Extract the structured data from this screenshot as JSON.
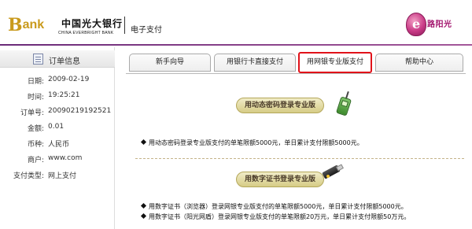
{
  "header": {
    "bank_logo_b": "B",
    "bank_logo_rest": "ank",
    "bank_name_cn": "中国光大银行",
    "bank_name_en": "CHINA EVERBRIGHT BANK",
    "section_title": "电子支付",
    "brand_right": "路阳光"
  },
  "sidebar": {
    "title": "订单信息",
    "rows": [
      {
        "label": "日期:",
        "value": "2009-02-19"
      },
      {
        "label": "时间:",
        "value": "19:25:21"
      },
      {
        "label": "订单号:",
        "value": "20090219192521"
      },
      {
        "label": "金额:",
        "value": "0.01"
      },
      {
        "label": "币种:",
        "value": "人民币"
      },
      {
        "label": "商户:",
        "value": "www.com"
      },
      {
        "label": "支付类型:",
        "value": "网上支付"
      }
    ]
  },
  "tabs": [
    {
      "label": "新手向导",
      "active": false
    },
    {
      "label": "用银行卡直接支付",
      "active": false
    },
    {
      "label": "用网银专业版支付",
      "active": true
    },
    {
      "label": "帮助中心",
      "active": false
    }
  ],
  "content": {
    "dynamic_password": {
      "button_label": "用动态密码登录专业版",
      "notes": [
        "用动态密码登录专业版支付的单笔限额5000元，单日累计支付限额5000元。"
      ]
    },
    "digital_certificate": {
      "button_label": "用数字证书登录专业版",
      "notes": [
        "用数字证书（浏览器）登录网银专业版支付的单笔限额5000元，单日累计支付限额5000元。",
        "用数字证书（阳光网盾）登录网银专业版支付的单笔限额20万元，单日累计支付限额50万元。"
      ]
    }
  },
  "colors": {
    "header_line": "#6a2a78",
    "active_tab_border": "#e1121a",
    "logo_gold": "#c99a1c",
    "brand_magenta": "#a3156d",
    "section_button_fill": "#e6dfa8"
  },
  "icons": {
    "order": "document-list-icon",
    "dynamic_password": "mobile-phone-icon",
    "digital_certificate": "usb-key-icon"
  }
}
